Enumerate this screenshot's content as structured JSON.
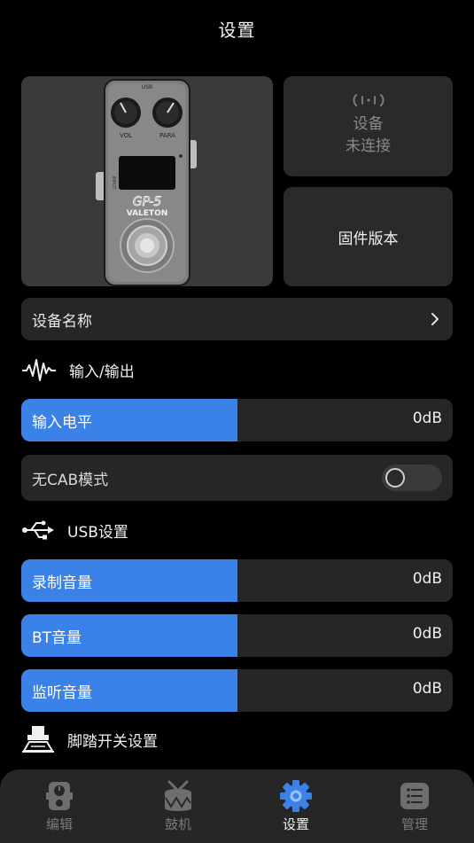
{
  "header": {
    "title": "设置"
  },
  "pedal": {
    "knob_left_label": "VOL",
    "knob_right_label": "PARA",
    "usb_label": "USB",
    "side_label": "INPUT",
    "model": "GP-5",
    "brand": "VALETON"
  },
  "device_status": {
    "line1": "设备",
    "line2": "未连接"
  },
  "firmware": {
    "label": "固件版本"
  },
  "device_name": {
    "label": "设备名称"
  },
  "io_section": {
    "title": "输入/输出"
  },
  "input_level": {
    "label": "输入电平",
    "value": "0dB",
    "fill_fraction": 0.5
  },
  "no_cab": {
    "label": "无CAB模式",
    "enabled": false
  },
  "usb_section": {
    "title": "USB设置"
  },
  "record_volume": {
    "label": "录制音量",
    "value": "0dB",
    "fill_fraction": 0.5
  },
  "bt_volume": {
    "label": "BT音量",
    "value": "0dB",
    "fill_fraction": 0.5
  },
  "monitor_volume": {
    "label": "监听音量",
    "value": "0dB",
    "fill_fraction": 0.5
  },
  "footswitch_section": {
    "title": "脚踏开关设置"
  },
  "tabs": [
    {
      "label": "编辑",
      "icon": "pedal-icon",
      "active": false
    },
    {
      "label": "鼓机",
      "icon": "drum-icon",
      "active": false
    },
    {
      "label": "设置",
      "icon": "gear-icon",
      "active": true
    },
    {
      "label": "管理",
      "icon": "list-icon",
      "active": false
    }
  ],
  "colors": {
    "accent": "#3b82e8",
    "background": "#000000",
    "card": "#2a2a2a",
    "inactive": "#7a7a7a"
  }
}
